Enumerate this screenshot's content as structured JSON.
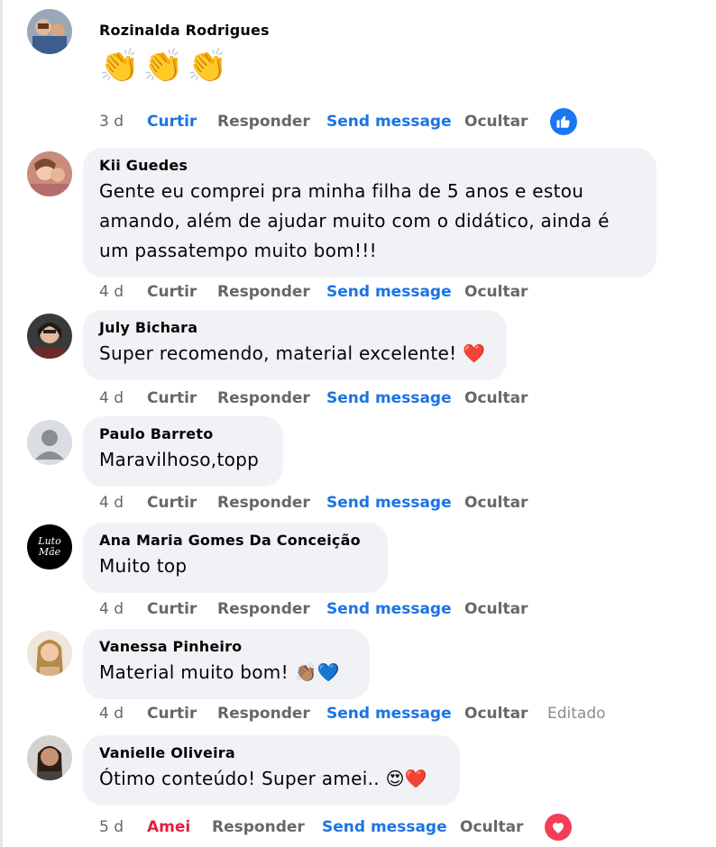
{
  "comments": [
    {
      "author": "Rozinalda Rodrigues",
      "text": "",
      "emoji": [
        "👏",
        "👏",
        "👏"
      ],
      "time": "3 d",
      "like": "Curtir",
      "reply": "Responder",
      "send": "Send message",
      "hide": "Ocultar",
      "reaction": "like-icon"
    },
    {
      "author": "Kii Guedes",
      "text_lines": [
        "Gente eu comprei pra minha filha de 5 anos e estou",
        "amando, além de ajudar muito com o didático, ainda é",
        "um passatempo muito bom!!!"
      ],
      "time": "4 d",
      "like": "Curtir",
      "reply": "Responder",
      "send": "Send message",
      "hide": "Ocultar"
    },
    {
      "author": "July Bichara",
      "text": "Super recomendo, material excelente! ❤️",
      "time": "4 d",
      "like": "Curtir",
      "reply": "Responder",
      "send": "Send message",
      "hide": "Ocultar"
    },
    {
      "author": "Paulo Barreto",
      "text": "Maravilhoso,topp",
      "time": "4 d",
      "like": "Curtir",
      "reply": "Responder",
      "send": "Send message",
      "hide": "Ocultar"
    },
    {
      "author": "Ana Maria Gomes Da Conceição",
      "text": "Muito top",
      "time": "4 d",
      "like": "Curtir",
      "reply": "Responder",
      "send": "Send message",
      "hide": "Ocultar",
      "avatar_logo": [
        "Luto",
        "Mãe"
      ]
    },
    {
      "author": "Vanessa Pinheiro",
      "text": "Material muito bom! 👏🏽💙",
      "time": "4 d",
      "like": "Curtir",
      "reply": "Responder",
      "send": "Send message",
      "hide": "Ocultar",
      "edited": "Editado"
    },
    {
      "author": "Vanielle Oliveira",
      "text": "Ótimo conteúdo! Super amei.. 😍❤️",
      "time": "5 d",
      "like": "Amei",
      "reply": "Responder",
      "send": "Send message",
      "hide": "Ocultar",
      "reaction": "love-icon"
    }
  ],
  "colors": {
    "bubble": "#f0f2f5",
    "link_blue": "#1b74e4",
    "love_red": "#e41e3f",
    "muted": "#65676b"
  }
}
